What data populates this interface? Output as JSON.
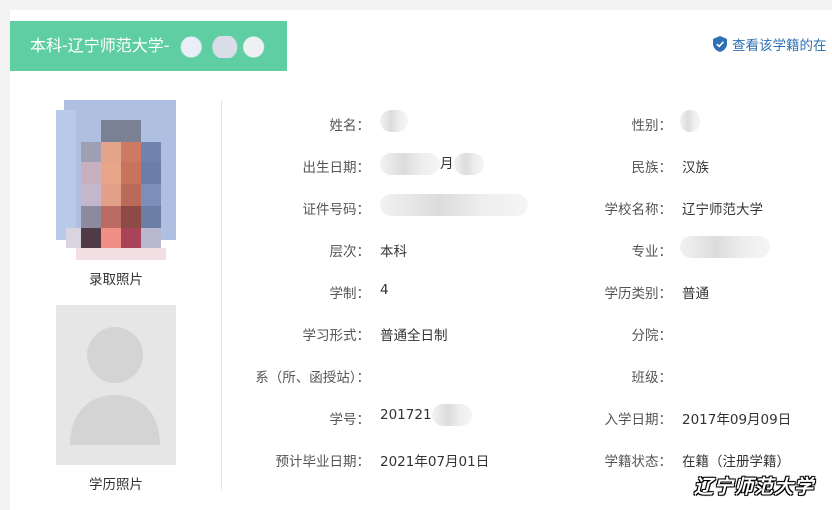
{
  "header": {
    "tab_title": "本科-辽宁师范大学-",
    "verify_link": "查看该学籍的在"
  },
  "photos": {
    "admission_caption": "录取照片",
    "degree_caption": "学历照片"
  },
  "fields": {
    "name_label": "姓名：",
    "gender_label": "性别：",
    "birth_label": "出生日期：",
    "birth_value": "月",
    "ethnicity_label": "民族：",
    "ethnicity_value": "汉族",
    "id_label": "证件号码：",
    "school_label": "学校名称：",
    "school_value": "辽宁师范大学",
    "level_label": "层次：",
    "level_value": "本科",
    "major_label": "专业：",
    "duration_label": "学制：",
    "duration_value": "4",
    "edu_type_label": "学历类别：",
    "edu_type_value": "普通",
    "study_form_label": "学习形式：",
    "study_form_value": "普通全日制",
    "branch_label": "分院：",
    "dept_label": "系（所、函授站）：",
    "class_label": "班级：",
    "student_no_label": "学号：",
    "student_no_value": "201721",
    "enroll_date_label": "入学日期：",
    "enroll_date_value": "2017年09月09日",
    "grad_date_label": "预计毕业日期：",
    "grad_date_value": "2021年07月01日",
    "status_label": "学籍状态：",
    "status_value": "在籍（注册学籍）"
  },
  "watermark": "辽宁师范大学",
  "colors": {
    "tab_bg": "#5fcfa3",
    "link": "#2f6fb3"
  }
}
